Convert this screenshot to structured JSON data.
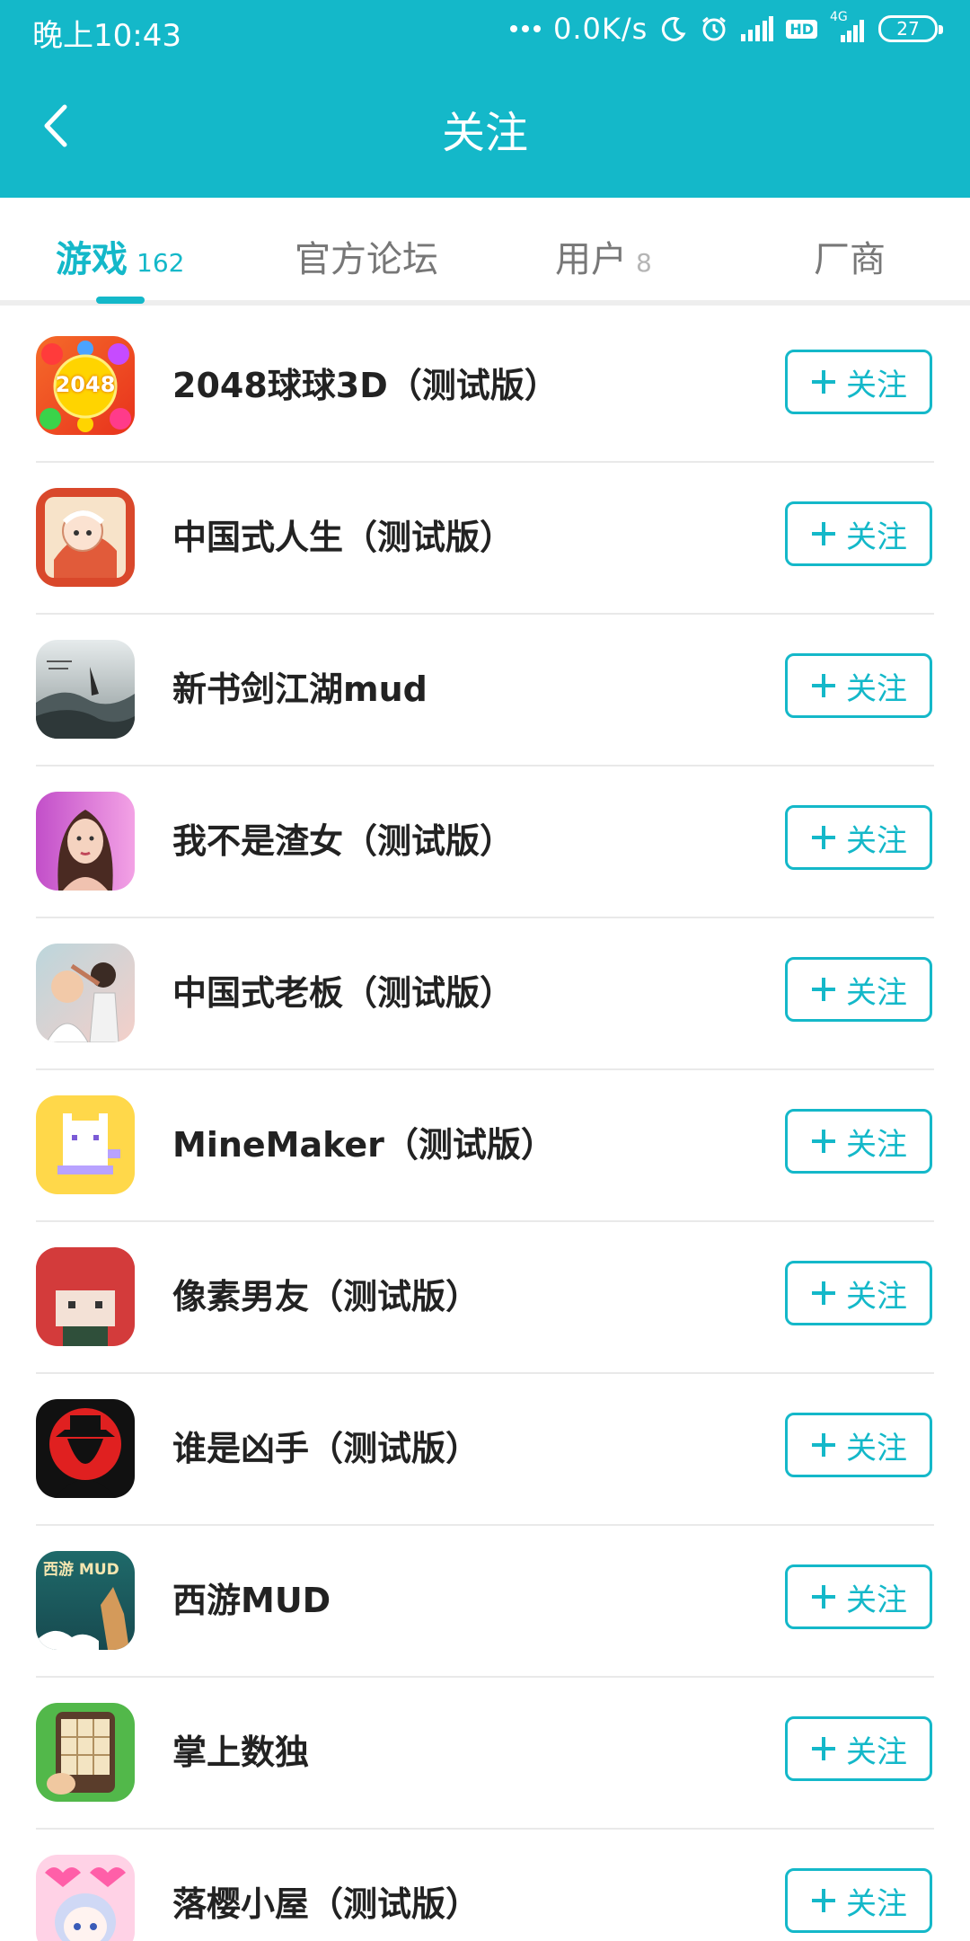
{
  "status_bar": {
    "time": "晚上10:43",
    "network_speed": "0.0K/s",
    "network_type": "4G",
    "hd_label": "HD",
    "battery": "27",
    "icons": [
      "dots-icon",
      "moon-icon",
      "alarm-icon",
      "signal-icon",
      "hd-icon",
      "signal-4g-icon",
      "battery-icon"
    ]
  },
  "header": {
    "title": "关注",
    "back_icon": "chevron-left-icon"
  },
  "tabs": [
    {
      "label": "游戏",
      "count": "162",
      "active": true
    },
    {
      "label": "官方论坛",
      "count": "",
      "active": false
    },
    {
      "label": "用户",
      "count": "8",
      "active": false
    },
    {
      "label": "厂商",
      "count": "",
      "active": false
    }
  ],
  "games": [
    {
      "name": "2048球球3D（测试版）",
      "button": "关注"
    },
    {
      "name": "中国式人生（测试版）",
      "button": "关注"
    },
    {
      "name": "新书剑江湖mud",
      "button": "关注"
    },
    {
      "name": "我不是渣女（测试版）",
      "button": "关注"
    },
    {
      "name": "中国式老板（测试版）",
      "button": "关注"
    },
    {
      "name": "MineMaker（测试版）",
      "button": "关注"
    },
    {
      "name": "像素男友（测试版）",
      "button": "关注"
    },
    {
      "name": "谁是凶手（测试版）",
      "button": "关注"
    },
    {
      "name": "西游MUD",
      "button": "关注"
    },
    {
      "name": "掌上数独",
      "button": "关注"
    },
    {
      "name": "落樱小屋（测试版）",
      "button": "关注"
    }
  ],
  "icon_labels": {
    "game_2048": "2048",
    "game_xiyou": "西游 MUD"
  },
  "colors": {
    "accent": "#14b8c9",
    "text_primary": "#222222",
    "text_secondary": "#777777",
    "divider": "#e9e9e9"
  }
}
